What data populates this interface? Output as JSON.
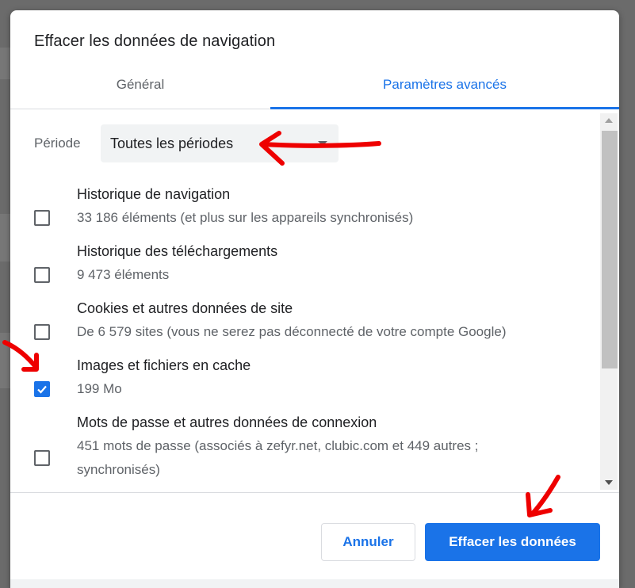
{
  "dialog": {
    "title": "Effacer les données de navigation",
    "tabs": [
      {
        "label": "Général",
        "active": false
      },
      {
        "label": "Paramètres avancés",
        "active": true
      }
    ]
  },
  "period": {
    "label": "Période",
    "selected": "Toutes les périodes"
  },
  "items": [
    {
      "title": "Historique de navigation",
      "subtitle": "33 186 éléments (et plus sur les appareils synchronisés)",
      "checked": false
    },
    {
      "title": "Historique des téléchargements",
      "subtitle": "9 473 éléments",
      "checked": false
    },
    {
      "title": "Cookies et autres données de site",
      "subtitle": "De 6 579 sites (vous ne serez pas déconnecté de votre compte Google)",
      "checked": false
    },
    {
      "title": "Images et fichiers en cache",
      "subtitle": "199 Mo",
      "checked": true
    },
    {
      "title": "Mots de passe et autres données de connexion",
      "subtitle": "451 mots de passe (associés à zefyr.net, clubic.com et 449 autres ; synchronisés)",
      "checked": false
    }
  ],
  "footer": {
    "cancel_label": "Annuler",
    "clear_label": "Effacer les données"
  },
  "colors": {
    "accent": "#1a73e8",
    "annotation": "#ee0000"
  }
}
